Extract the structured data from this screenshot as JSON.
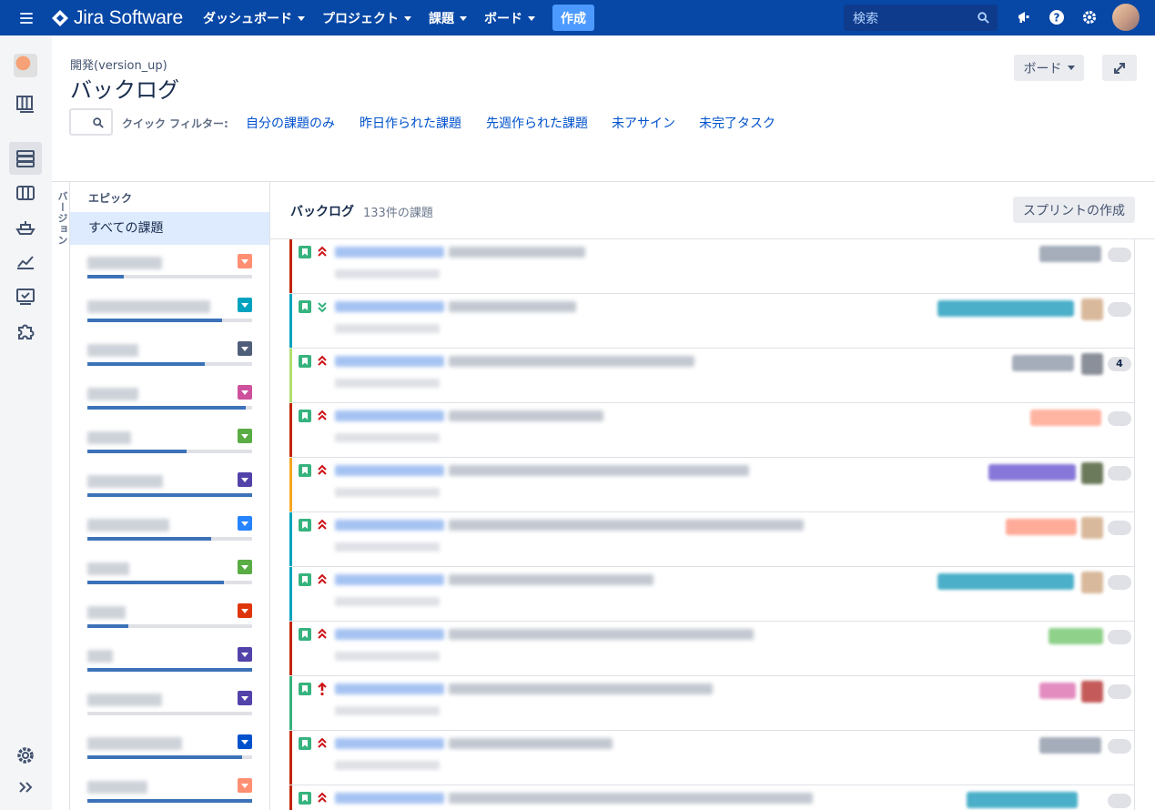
{
  "nav": {
    "logo_text": "Jira Software",
    "items": [
      {
        "label": "ダッシュボード"
      },
      {
        "label": "プロジェクト"
      },
      {
        "label": "課題"
      },
      {
        "label": "ボード"
      }
    ],
    "create_label": "作成",
    "search_placeholder": "検索"
  },
  "header": {
    "breadcrumb": "開発(version_up)",
    "title": "バックログ",
    "board_button": "ボード"
  },
  "quick_filters": {
    "label": "クイック フィルター:",
    "links": [
      "自分の課題のみ",
      "昨日作られた課題",
      "先週作られた課題",
      "未アサイン",
      "未完了タスク"
    ]
  },
  "versions_tab": "バージョン",
  "epics": {
    "header": "エピック",
    "all_label": "すべての課題",
    "items": [
      {
        "color": "#ff8f73",
        "progress": 0.22
      },
      {
        "color": "#00a3bf",
        "progress": 0.82
      },
      {
        "color": "#505f79",
        "progress": 0.71
      },
      {
        "color": "#cd519d",
        "progress": 0.96
      },
      {
        "color": "#5aac44",
        "progress": 0.6
      },
      {
        "color": "#5243aa",
        "progress": 1.0
      },
      {
        "color": "#2684ff",
        "progress": 0.75
      },
      {
        "color": "#5aac44",
        "progress": 0.83
      },
      {
        "color": "#de350b",
        "progress": 0.25
      },
      {
        "color": "#5243aa",
        "progress": 1.0
      },
      {
        "color": "#5243aa",
        "progress": 0.0
      },
      {
        "color": "#0052cc",
        "progress": 0.94
      },
      {
        "color": "#ff8f73",
        "progress": 1.0
      }
    ]
  },
  "backlog": {
    "title": "バックログ",
    "count_text": "133件の課題",
    "create_sprint_label": "スプリントの作成",
    "issues": [
      {
        "rail": "#bf2600",
        "priority": "highest",
        "epic_color": "#a5adba",
        "assignee_color": "",
        "estimate": ""
      },
      {
        "rail": "#00a3bf",
        "priority": "lowest",
        "epic_color": "#4bafc9",
        "assignee_color": "#d9b99b",
        "estimate": ""
      },
      {
        "rail": "#b3df72",
        "priority": "highest",
        "epic_color": "#a5adba",
        "assignee_color": "#8a8f99",
        "estimate": "4"
      },
      {
        "rail": "#bf2600",
        "priority": "highest",
        "epic_color": "#ffb3a1",
        "assignee_color": "",
        "estimate": ""
      },
      {
        "rail": "#f6a623",
        "priority": "highest",
        "epic_color": "#8777d9",
        "assignee_color": "#6b7a5a",
        "estimate": ""
      },
      {
        "rail": "#00a3bf",
        "priority": "highest",
        "epic_color": "#ffab99",
        "assignee_color": "#d9b99b",
        "estimate": ""
      },
      {
        "rail": "#00a3bf",
        "priority": "highest",
        "epic_color": "#4bafc9",
        "assignee_color": "#d9b99b",
        "estimate": ""
      },
      {
        "rail": "#bf2600",
        "priority": "highest",
        "epic_color": "#8fd18b",
        "assignee_color": "",
        "estimate": ""
      },
      {
        "rail": "#36b37e",
        "priority": "blocker",
        "epic_color": "#e38cc0",
        "assignee_color": "#c45a5a",
        "estimate": ""
      },
      {
        "rail": "#bf2600",
        "priority": "highest",
        "epic_color": "#a5adba",
        "assignee_color": "",
        "estimate": ""
      },
      {
        "rail": "#bf2600",
        "priority": "highest",
        "epic_color": "#4bafc9",
        "assignee_color": "",
        "estimate": ""
      }
    ]
  }
}
